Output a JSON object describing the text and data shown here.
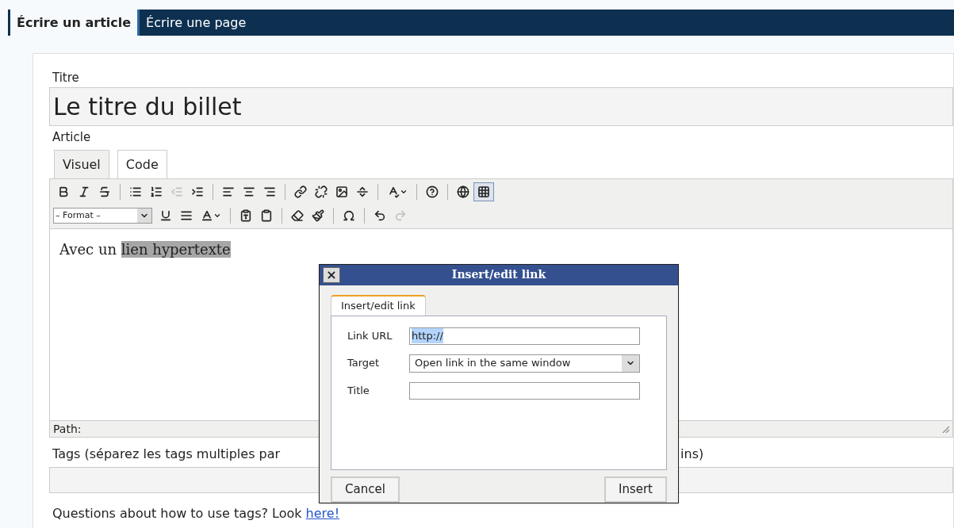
{
  "page_tabs": [
    {
      "label": "Écrire un article",
      "selected": true
    },
    {
      "label": "Écrire une page",
      "selected": false
    }
  ],
  "title_field": {
    "label": "Titre",
    "value": "Le titre du billet"
  },
  "article": {
    "label": "Article",
    "editor_tabs": [
      {
        "label": "Visuel",
        "selected": true
      },
      {
        "label": "Code",
        "selected": false
      }
    ],
    "toolbar_row_1": [
      {
        "disabled": false,
        "selected": false
      },
      {
        "disabled": false,
        "selected": false
      },
      {
        "disabled": false,
        "selected": false
      },
      {
        "disabled": false,
        "selected": false
      },
      {
        "disabled": false,
        "selected": false
      },
      {
        "disabled": true,
        "selected": false
      },
      {
        "disabled": false,
        "selected": false
      },
      {
        "disabled": false,
        "selected": false
      },
      {
        "disabled": false,
        "selected": false
      },
      {
        "disabled": false,
        "selected": false
      },
      {
        "disabled": false,
        "selected": false
      },
      {
        "disabled": false,
        "selected": false
      },
      {
        "disabled": false,
        "selected": false
      },
      {
        "disabled": false,
        "selected": false
      },
      {
        "disabled": false,
        "selected": false
      },
      {
        "disabled": false,
        "selected": false
      },
      {
        "disabled": false,
        "selected": false
      },
      {
        "disabled": false,
        "selected": true
      }
    ],
    "format_select": "– Format –",
    "toolbar_row_2": [
      {
        "disabled": false,
        "selected": false
      },
      {
        "disabled": false,
        "selected": false
      },
      {
        "disabled": false,
        "selected": false
      },
      {
        "disabled": false,
        "selected": false
      },
      {
        "disabled": false,
        "selected": false
      },
      {
        "disabled": false,
        "selected": false
      },
      {
        "disabled": false,
        "selected": false
      },
      {
        "disabled": false,
        "selected": false
      },
      {
        "disabled": false,
        "selected": false
      },
      {
        "disabled": true,
        "selected": false
      }
    ],
    "content": {
      "text": "Avec un ",
      "selected_text": "lien hypertexte"
    },
    "path_label": "Path:"
  },
  "tags": {
    "label_start": "Tags (séparez les tags multiples par",
    "label_end": "ins)",
    "help": "Questions about how to use tags? Look",
    "help_link": "here!"
  },
  "dialog": {
    "title": "Insert/edit link",
    "close": "×",
    "tabs": [
      {
        "label": "Insert/edit link",
        "selected": true
      }
    ],
    "fields": [
      {
        "kind": "text",
        "label": "Link URL",
        "value": "http://",
        "selected": true
      },
      {
        "kind": "select",
        "label": "Target",
        "value": "Open link in the same window"
      },
      {
        "kind": "text",
        "label": "Title"
      }
    ],
    "buttons": [
      "Cancel",
      "Insert"
    ]
  }
}
